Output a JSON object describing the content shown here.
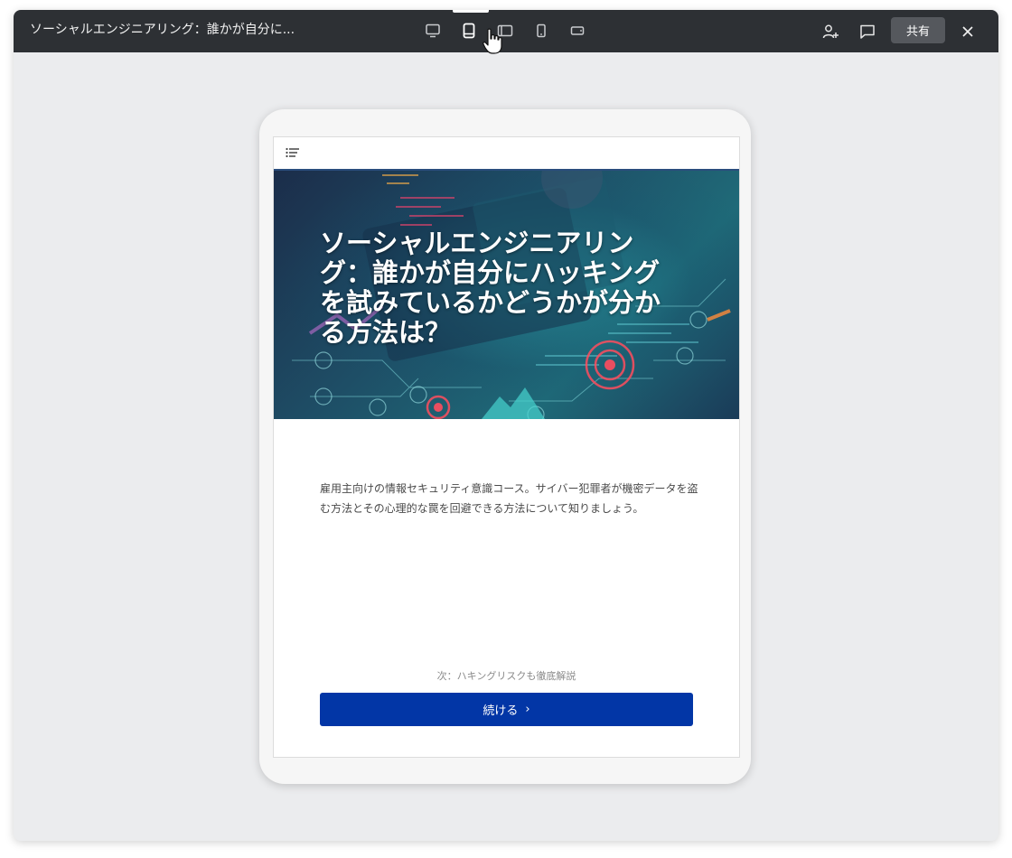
{
  "window": {
    "title": "ソーシャルエンジニアリング：誰かが自分に...",
    "share_label": "共有"
  },
  "toolbar": {
    "devices": [
      {
        "icon": "desktop-icon",
        "active": false
      },
      {
        "icon": "tablet-portrait-icon",
        "active": true
      },
      {
        "icon": "tablet-landscape-icon",
        "active": false
      },
      {
        "icon": "phone-portrait-icon",
        "active": false
      },
      {
        "icon": "phone-landscape-icon",
        "active": false
      }
    ],
    "tools": [
      "add-user-icon",
      "comment-icon",
      "close-icon"
    ]
  },
  "preview": {
    "menu_icon": "list-menu-icon",
    "hero_title": "ソーシャルエンジニアリング：誰かが自分にハッキングを試みているかどうかが分かる方法は？",
    "description": "雇用主向けの情報セキュリティ意識コース。サイバー犯罪者が機密データを盗む方法とその心理的な罠を回避できる方法について知りましょう。",
    "next_label": "次：ハキングリスクも徹底解説",
    "continue_label": "続ける",
    "continue_arrow": "›"
  },
  "colors": {
    "topbar": "#2d3034",
    "workspace": "#ebecee",
    "accent_button": "#0236a6",
    "header_rule": "#2a4d7d"
  }
}
